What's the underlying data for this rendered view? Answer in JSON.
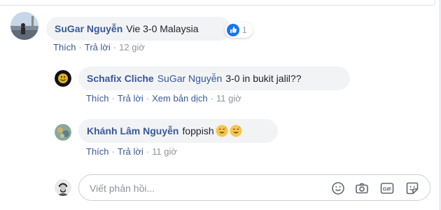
{
  "comments": [
    {
      "author": "SuGar Nguyễn",
      "text": "Vie 3-0 Malaysia",
      "reaction_count": "1",
      "actions": {
        "like": "Thích",
        "reply": "Trả lời",
        "time": "12 giờ"
      }
    }
  ],
  "replies": [
    {
      "author": "Schafix Cliche",
      "mention": "SuGar Nguyễn",
      "text": "3-0 in bukit jalil??",
      "actions": {
        "like": "Thích",
        "reply": "Trả lời",
        "translate": "Xem bản dịch",
        "time": "11 giờ"
      }
    },
    {
      "author": "Khánh Lâm Nguyễn",
      "text": "foppish",
      "actions": {
        "like": "Thích",
        "reply": "Trả lời",
        "time": "11 giờ"
      }
    }
  ],
  "reply_box": {
    "placeholder": "Viết phản hồi..."
  },
  "icons": {
    "reaction": "like-icon",
    "emoji": "emoji-icon",
    "camera": "camera-icon",
    "gif": "gif-icon",
    "sticker": "sticker-icon"
  },
  "colors": {
    "link": "#385898",
    "bubble": "#f2f3f5",
    "meta": "#90949c",
    "like_blue": "#1877f2"
  }
}
